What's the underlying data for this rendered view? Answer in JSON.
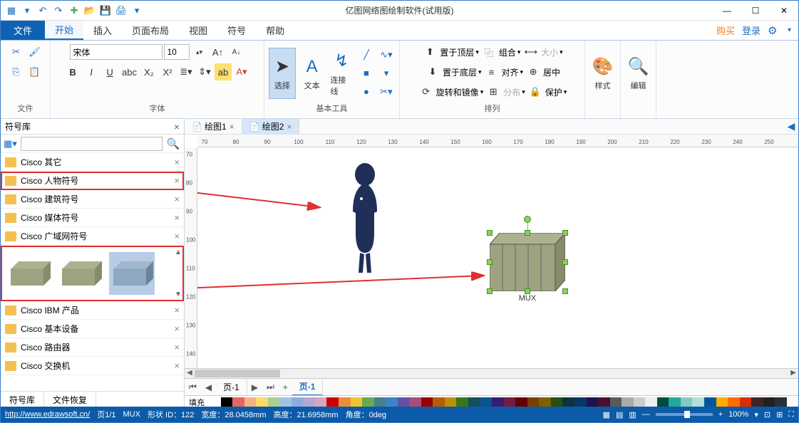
{
  "title": "亿图网络图绘制软件(试用版)",
  "menubar": {
    "file": "文件",
    "tabs": [
      "开始",
      "插入",
      "页面布局",
      "视图",
      "符号",
      "帮助"
    ],
    "active": 0,
    "buy": "购买",
    "login": "登录"
  },
  "ribbon": {
    "file_group": "文件",
    "font_group": "字体",
    "font_name": "宋体",
    "font_size": "10",
    "bold": "B",
    "italic": "I",
    "underline": "U",
    "tools_group": "基本工具",
    "select": "选择",
    "text": "文本",
    "connector": "连接线",
    "arrange_group": "排列",
    "top_layer": "置于顶层",
    "bottom_layer": "置于底层",
    "rotate_mirror": "旋转和镜像",
    "group": "组合",
    "align": "对齐",
    "distribute": "分布",
    "size": "大小",
    "center": "居中",
    "protect": "保护",
    "style": "样式",
    "edit": "编辑"
  },
  "sidebar": {
    "title": "符号库",
    "search_placeholder": "",
    "items": [
      "Cisco 其它",
      "Cisco 人物符号",
      "Cisco 建筑符号",
      "Cisco 媒体符号",
      "Cisco 广域网符号",
      "Cisco IBM 产品",
      "Cisco 基本设备",
      "Cisco 路由器",
      "Cisco 交换机"
    ],
    "tabs": [
      "符号库",
      "文件恢复"
    ]
  },
  "doc_tabs": [
    "绘图1",
    "绘图2"
  ],
  "doc_active": 1,
  "ruler_h": [
    70,
    80,
    90,
    100,
    110,
    120,
    130,
    140,
    150,
    160,
    170,
    180,
    190,
    200,
    210,
    220,
    230,
    240,
    250
  ],
  "ruler_v": [
    70,
    80,
    90,
    100,
    110,
    120,
    130,
    140
  ],
  "canvas": {
    "mux_label": "MUX"
  },
  "page_tabs": {
    "page": "页-1",
    "page2": "页-1"
  },
  "palette_label": "填充",
  "status": {
    "url": "http://www.edrawsoft.cn/",
    "page": "页1/1",
    "shape": "MUX",
    "shape_id_label": "形状 ID：",
    "shape_id": "122",
    "width_label": "宽度：",
    "width": "28.0458mm",
    "height_label": "高度：",
    "height": "21.6958mm",
    "angle_label": "角度：",
    "angle": "0deg",
    "zoom": "100%"
  },
  "palette_colors": [
    "#fff",
    "#000",
    "#e06666",
    "#f4b183",
    "#ffd966",
    "#a9d18e",
    "#9dc3e6",
    "#8faadc",
    "#b4a7d6",
    "#d5a6bd",
    "#cc0000",
    "#e69138",
    "#f1c232",
    "#6aa84f",
    "#45818e",
    "#3d85c6",
    "#674ea7",
    "#a64d79",
    "#990000",
    "#b45f06",
    "#bf9000",
    "#38761d",
    "#134f5c",
    "#0b5394",
    "#351c75",
    "#741b47",
    "#660000",
    "#783f04",
    "#7f6000",
    "#274e13",
    "#0c343d",
    "#073763",
    "#20124d",
    "#4c1130",
    "#5b5b5b",
    "#aaa",
    "#ccc",
    "#eee",
    "#004d40",
    "#26a69a",
    "#80cbc4",
    "#b2dfdb",
    "#01579b",
    "#ffab00",
    "#ff6d00",
    "#dd2c00",
    "#3e2723",
    "#212121",
    "#263238",
    "#fafafa"
  ]
}
